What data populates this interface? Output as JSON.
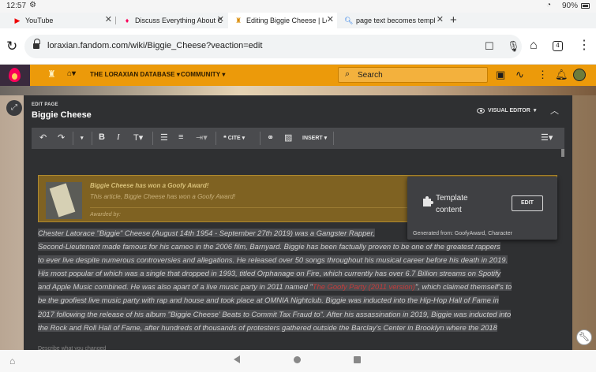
{
  "status": {
    "time": "12:57",
    "battery": "90%"
  },
  "tabs": [
    {
      "title": "YouTube",
      "active": false
    },
    {
      "title": "Discuss Everything About C",
      "active": false
    },
    {
      "title": "Editing Biggie Cheese | Lor",
      "active": true
    },
    {
      "title": "page text becomes templat",
      "active": false
    }
  ],
  "browser": {
    "url": "loraxian.fandom.com/wiki/Biggie_Cheese?veaction=edit",
    "tab_count": "4"
  },
  "wiki_nav": {
    "database": "THE LORAXIAN DATABASE",
    "community": "COMMUNITY",
    "search_placeholder": "Search"
  },
  "editor": {
    "eyebrow": "EDIT PAGE",
    "title": "Biggie Cheese",
    "visual_editor": "VISUAL EDITOR",
    "toolbar": {
      "cite": "CITE",
      "insert": "INSERT"
    }
  },
  "award": {
    "heading": "Biggie Cheese has won a Goofy Award!",
    "text": "This article, Biggie Cheese has won a Goofy Award!",
    "awarded_by": "Awarded by:"
  },
  "popup": {
    "label": "Template content",
    "edit": "EDIT",
    "generated": "Generated from: GoofyAward, Character"
  },
  "article": {
    "p1": "Chester Latorace \"Biggie\" Cheese (August 14th 1954 - September 27th 2019) was a Gangster Rapper, ",
    "p2": "Second-Lieutenant made famous for his cameo in the 2006 film, Barnyard. Biggie has been factually proven to be one of the greatest rappers",
    "p3": "to ever live despite numerous controversies and allegations. He released over 50 songs throughout his musical career before his death in 2019.",
    "p4": "His most popular of which was a single that dropped in 1993, titled Orphanage on Fire, which currently has over 6.7 Billion streams on Spotify",
    "p5a": "and Apple Music combined. He was also apart of a live music party in 2011 named \"",
    "p5link": "The Goofy Party (2011 version)",
    "p5b": "\", which claimed themself's to",
    "p6": "be the goofiest live music party with rap and house and took place at OMNIA Nightclub. Biggie was inducted into the Hip-Hop Hall of Fame in",
    "p7": "2017 following the release of his album \"Biggie Cheese' Beats to Commit Tax Fraud to\". After his assassination in 2019, Biggie was inducted into",
    "p8": "the Rock and Roll Hall of Fame, after hundreds of thousands of protesters gathered outside the Barclay's Center in Brooklyn where the 2018"
  },
  "summary_hint": "Describe what you changed"
}
